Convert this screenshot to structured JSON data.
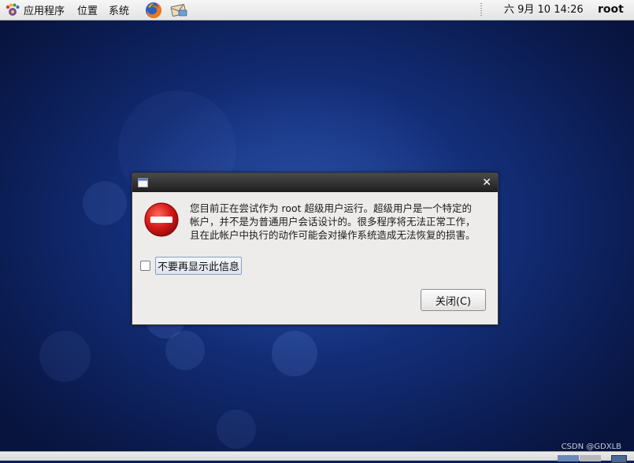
{
  "topbar": {
    "menus": [
      {
        "label": "应用程序",
        "icon": "gnome-foot-icon"
      },
      {
        "label": "位置"
      },
      {
        "label": "系统"
      }
    ],
    "launchers": [
      "firefox-icon",
      "mail-icon"
    ],
    "clock": "六 9月 10 14:26",
    "user": "root"
  },
  "dialog": {
    "icon": "stop-error-icon",
    "message_lines": [
      "您目前正在尝试作为 root 超级用户运行。超级用户是一个特定的",
      "帐户，并不是为普通用户会话设计的。很多程序将无法正常工作，",
      "且在此帐户中执行的动作可能会对操作系统造成无法恢复的损害。"
    ],
    "checkbox_label": "不要再显示此信息",
    "checkbox_checked": false,
    "close_button": "关闭(C)"
  },
  "watermark": "CSDN @GDXLB",
  "colors": {
    "desktop": "#132e78",
    "panel": "#ececec",
    "dialog": "#edeceb",
    "titlebar": "#2a2a2a",
    "error_red": "#d61a1a"
  }
}
